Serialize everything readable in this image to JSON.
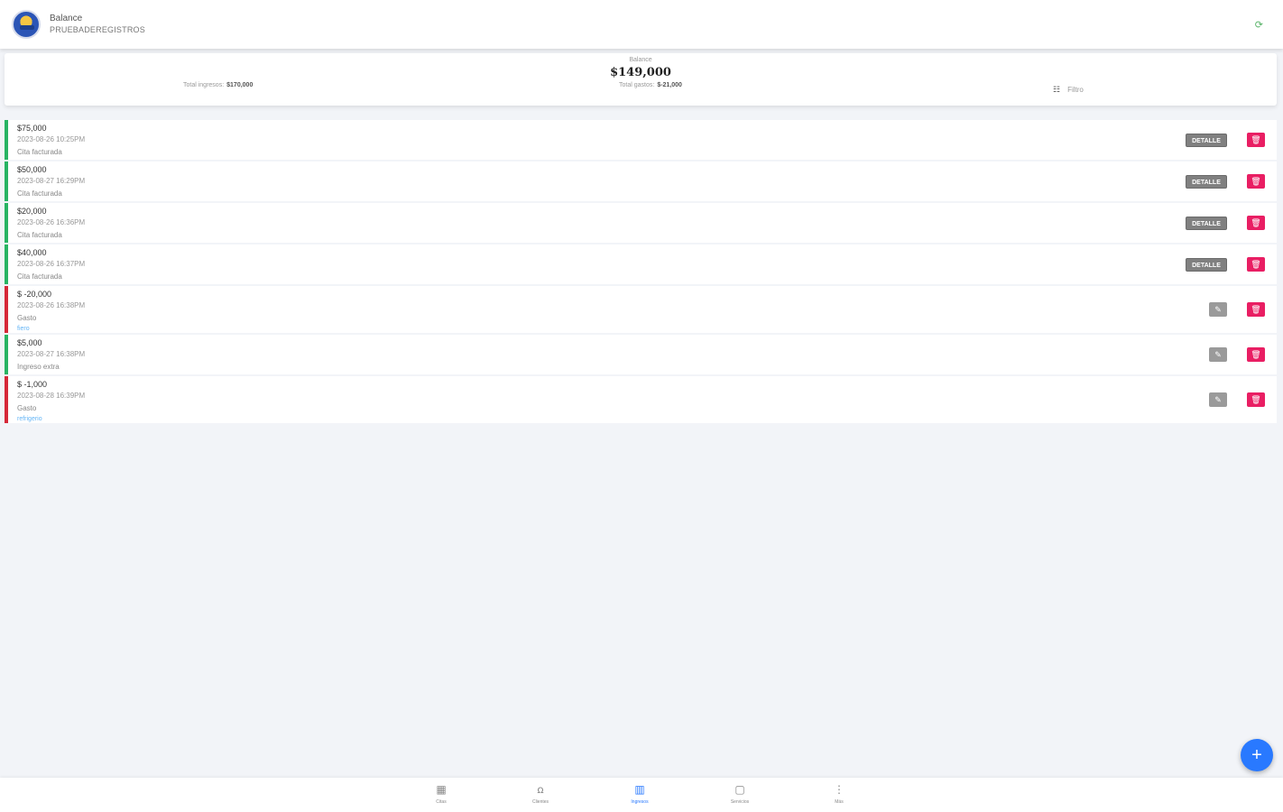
{
  "header": {
    "title": "Balance",
    "subtitle": "PRUEBADEREGISTROS",
    "refresh_icon": "refresh-icon"
  },
  "summary": {
    "balance_label": "Balance",
    "balance_value": "$149,000",
    "total_income_label": "Total ingresos:",
    "total_income_value": "$170,000",
    "total_expense_label": "Total gastos:",
    "total_expense_value": "$-21,000",
    "filter_icon": "sliders",
    "filter_label": "Filtro"
  },
  "records": [
    {
      "amount": "$75,000",
      "date": "2023-08-26 10:25PM",
      "description": "Cita facturada",
      "tag": "",
      "type": "income",
      "action": "DETALLE"
    },
    {
      "amount": "$50,000",
      "date": "2023-08-27 16:29PM",
      "description": "Cita facturada",
      "tag": "",
      "type": "income",
      "action": "DETALLE"
    },
    {
      "amount": "$20,000",
      "date": "2023-08-26 16:36PM",
      "description": "Cita facturada",
      "tag": "",
      "type": "income",
      "action": "DETALLE"
    },
    {
      "amount": "$40,000",
      "date": "2023-08-26 16:37PM",
      "description": "Cita facturada",
      "tag": "",
      "type": "income",
      "action": "DETALLE"
    },
    {
      "amount": "$ -20,000",
      "date": "2023-08-26 16:38PM",
      "description": "Gasto",
      "tag": "fiero",
      "type": "expense",
      "action": "edit"
    },
    {
      "amount": "$5,000",
      "date": "2023-08-27 16:38PM",
      "description": "Ingreso extra",
      "tag": "",
      "type": "income",
      "action": "edit"
    },
    {
      "amount": "$ -1,000",
      "date": "2023-08-28 16:39PM",
      "description": "Gasto",
      "tag": "refrigerio",
      "type": "expense",
      "action": "edit"
    }
  ],
  "fab_label": "+",
  "bottom_nav": [
    {
      "label": "Citas",
      "icon": "calendar-icon",
      "glyph": "▦",
      "active": false
    },
    {
      "label": "Clientes",
      "icon": "users-icon",
      "glyph": "ꭥ",
      "active": false
    },
    {
      "label": "Ingresos",
      "icon": "chart-icon",
      "glyph": "▥",
      "active": true
    },
    {
      "label": "Servicios",
      "icon": "clipboard-icon",
      "glyph": "▢",
      "active": false
    },
    {
      "label": "Más",
      "icon": "more-vertical-icon",
      "glyph": "⋮",
      "active": false
    }
  ]
}
